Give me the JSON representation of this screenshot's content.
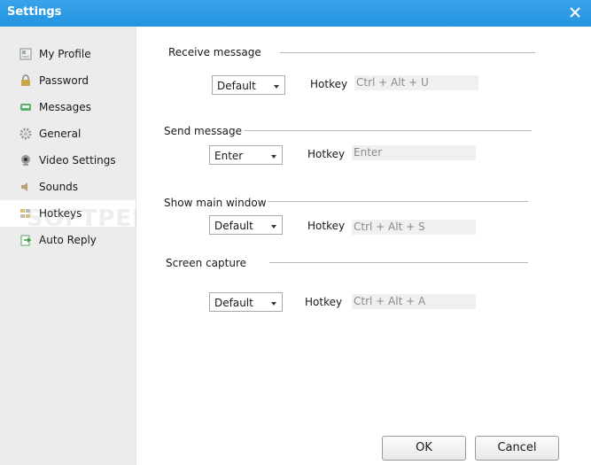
{
  "window": {
    "title": "Settings"
  },
  "sidebar": {
    "items": [
      {
        "label": "My Profile",
        "icon": "profile-card-icon",
        "active": false
      },
      {
        "label": "Password",
        "icon": "lock-icon",
        "active": false
      },
      {
        "label": "Messages",
        "icon": "message-icon",
        "active": false
      },
      {
        "label": "General",
        "icon": "gear-icon",
        "active": false
      },
      {
        "label": "Video Settings",
        "icon": "webcam-icon",
        "active": false
      },
      {
        "label": "Sounds",
        "icon": "speaker-icon",
        "active": false
      },
      {
        "label": "Hotkeys",
        "icon": "keyboard-icon",
        "active": true
      },
      {
        "label": "Auto Reply",
        "icon": "auto-reply-icon",
        "active": false
      }
    ]
  },
  "hotkeys": {
    "hotkey_label": "Hotkey",
    "sections": [
      {
        "title": "Receive message",
        "mode": "Default",
        "hotkey": "Ctrl + Alt + U"
      },
      {
        "title": "Send message",
        "mode": "Enter",
        "hotkey": "Enter"
      },
      {
        "title": "Show main window",
        "mode": "Default",
        "hotkey": "Ctrl + Alt + S"
      },
      {
        "title": "Screen capture",
        "mode": "Default",
        "hotkey": "Ctrl + Alt + A"
      }
    ]
  },
  "footer": {
    "ok_label": "OK",
    "cancel_label": "Cancel"
  },
  "watermark": "SOFTPEDIA"
}
